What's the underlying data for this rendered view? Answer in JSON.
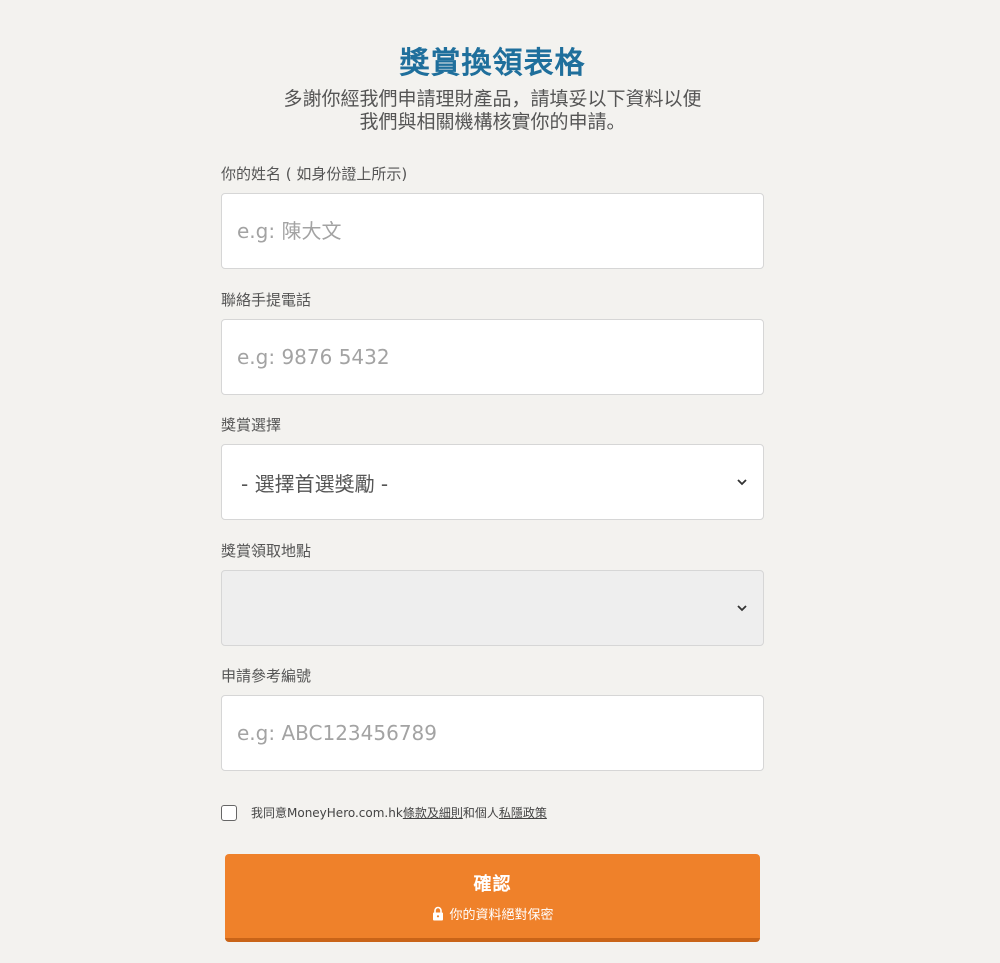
{
  "page": {
    "title": "獎賞換領表格",
    "subtitle_line1": "多謝你經我們申請理財產品，請填妥以下資料以便",
    "subtitle_line2": "我們與相關機構核實你的申請。"
  },
  "fields": {
    "name": {
      "label": "你的姓名 ( 如身份證上所示)",
      "placeholder": "e.g: 陳大文",
      "value": ""
    },
    "phone": {
      "label": "聯絡手提電話",
      "placeholder": "e.g: 9876 5432",
      "value": ""
    },
    "reward": {
      "label": "獎賞選擇",
      "selected": "- 選擇首選獎勵 -"
    },
    "location": {
      "label": "獎賞領取地點",
      "selected": ""
    },
    "reference": {
      "label": "申請參考編號",
      "placeholder": "e.g: ABC123456789",
      "value": ""
    }
  },
  "agreement": {
    "prefix": "我同意MoneyHero.com.hk",
    "terms_link": "條款及細則",
    "middle": "和個人",
    "privacy_link": "私隱政策",
    "checked": false
  },
  "submit": {
    "label": "確認",
    "sublabel": "你的資料絕對保密"
  },
  "colors": {
    "title": "#1f6f9c",
    "button": "#ef812a",
    "background": "#f3f2ef"
  },
  "icons": {
    "select_arrow": "chevron-down-icon",
    "lock": "lock-icon"
  }
}
